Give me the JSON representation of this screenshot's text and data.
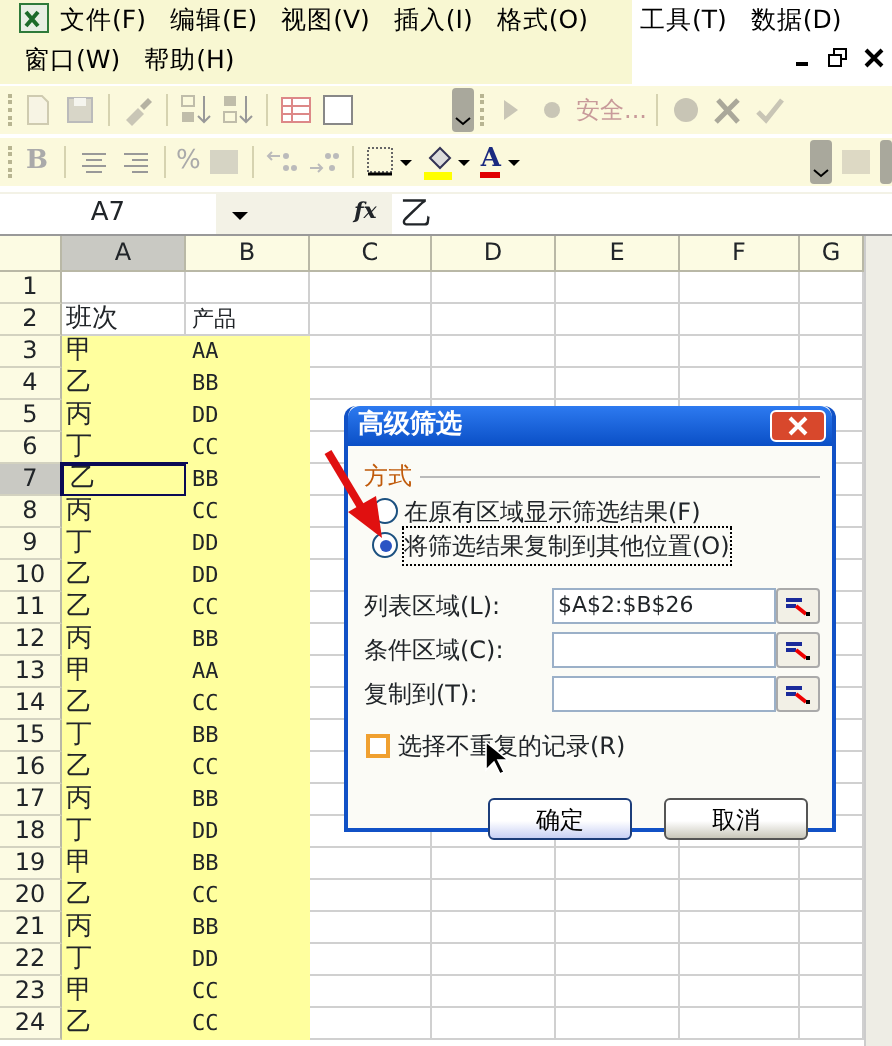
{
  "menu_bar": {
    "items": [
      {
        "label": "文件(F)"
      },
      {
        "label": "编辑(E)"
      },
      {
        "label": "视图(V)"
      },
      {
        "label": "插入(I)"
      },
      {
        "label": "格式(O)"
      },
      {
        "label": "工具(T)"
      },
      {
        "label": "数据(D)"
      },
      {
        "label": "窗口(W)"
      },
      {
        "label": "帮助(H)"
      }
    ]
  },
  "standard_toolbar": {
    "security_label": "安全..."
  },
  "formatting_toolbar": {
    "bold_label": "B",
    "percent_label": "%",
    "font_color_label": "A"
  },
  "formula_bar": {
    "name_box": "A7",
    "fx_label": "fx",
    "value": "乙"
  },
  "sheet": {
    "columns": [
      {
        "label": "A",
        "selected": true
      },
      {
        "label": "B",
        "selected": false
      },
      {
        "label": "C",
        "selected": false
      },
      {
        "label": "D",
        "selected": false
      },
      {
        "label": "E",
        "selected": false
      },
      {
        "label": "F",
        "selected": false
      },
      {
        "label": "G",
        "selected": false
      }
    ],
    "rows": [
      {
        "number": "1",
        "selected": false
      },
      {
        "number": "2",
        "a": "班次",
        "b": "产品",
        "selected": false
      },
      {
        "number": "3",
        "a": "甲",
        "b": "AA",
        "selected": false
      },
      {
        "number": "4",
        "a": "乙",
        "b": "BB",
        "selected": false
      },
      {
        "number": "5",
        "a": "丙",
        "b": "DD",
        "selected": false
      },
      {
        "number": "6",
        "a": "丁",
        "b": "CC",
        "selected": false
      },
      {
        "number": "7",
        "a": "乙",
        "b": "BB",
        "selected": true
      },
      {
        "number": "8",
        "a": "丙",
        "b": "CC",
        "selected": false
      },
      {
        "number": "9",
        "a": "丁",
        "b": "DD",
        "selected": false
      },
      {
        "number": "10",
        "a": "乙",
        "b": "DD",
        "selected": false
      },
      {
        "number": "11",
        "a": "乙",
        "b": "CC",
        "selected": false
      },
      {
        "number": "12",
        "a": "丙",
        "b": "BB",
        "selected": false
      },
      {
        "number": "13",
        "a": "甲",
        "b": "AA",
        "selected": false
      },
      {
        "number": "14",
        "a": "乙",
        "b": "CC",
        "selected": false
      },
      {
        "number": "15",
        "a": "丁",
        "b": "BB",
        "selected": false
      },
      {
        "number": "16",
        "a": "乙",
        "b": "CC",
        "selected": false
      },
      {
        "number": "17",
        "a": "丙",
        "b": "BB",
        "selected": false
      },
      {
        "number": "18",
        "a": "丁",
        "b": "DD",
        "selected": false
      },
      {
        "number": "19",
        "a": "甲",
        "b": "BB",
        "selected": false
      },
      {
        "number": "20",
        "a": "乙",
        "b": "CC",
        "selected": false
      },
      {
        "number": "21",
        "a": "丙",
        "b": "BB",
        "selected": false
      },
      {
        "number": "22",
        "a": "丁",
        "b": "DD",
        "selected": false
      },
      {
        "number": "23",
        "a": "甲",
        "b": "CC",
        "selected": false
      },
      {
        "number": "24",
        "a": "乙",
        "b": "CC",
        "selected": false
      }
    ]
  },
  "dialog": {
    "title": "高级筛选",
    "group_label": "方式",
    "options": [
      {
        "label": "在原有区域显示筛选结果(F)",
        "selected": false
      },
      {
        "label": "将筛选结果复制到其他位置(O)",
        "selected": true
      }
    ],
    "fields": [
      {
        "label": "列表区域(L):",
        "value": "$A$2:$B$26"
      },
      {
        "label": "条件区域(C):"
      },
      {
        "label": "复制到(T):"
      }
    ],
    "checkbox": {
      "label": "选择不重复的记录(R)",
      "checked": false
    },
    "buttons": [
      {
        "label": "确定",
        "default": true
      },
      {
        "label": "取消",
        "default": false
      }
    ]
  }
}
